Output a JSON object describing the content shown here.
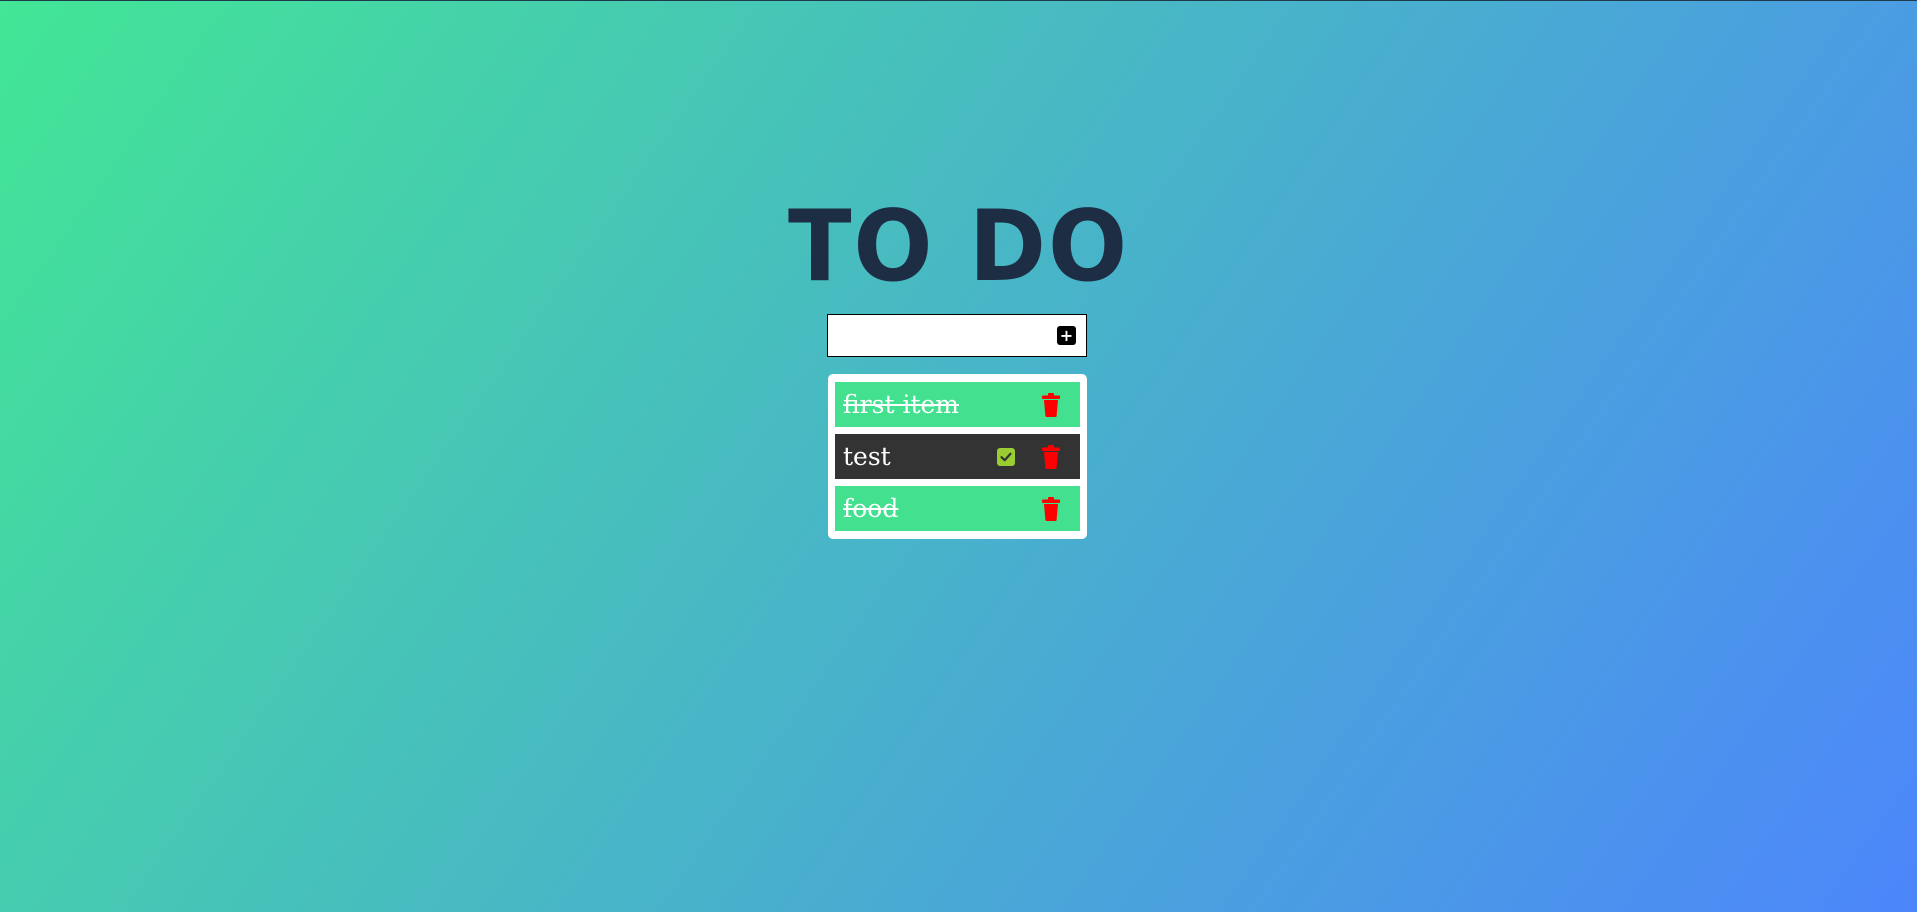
{
  "header": {
    "title": "TO DO"
  },
  "add_form": {
    "input_value": "",
    "placeholder": "",
    "add_icon": "plus-square-icon"
  },
  "todos": [
    {
      "text": "first item",
      "completed": true
    },
    {
      "text": "test",
      "completed": false
    },
    {
      "text": "food",
      "completed": true
    }
  ],
  "icons": {
    "check": "check-square-icon",
    "delete": "trash-icon"
  },
  "colors": {
    "title": "#1d2d44",
    "completed_item": "#42e08f",
    "pending_item": "#333333",
    "check_button": "#9acd32",
    "trash": "#ff0000"
  }
}
